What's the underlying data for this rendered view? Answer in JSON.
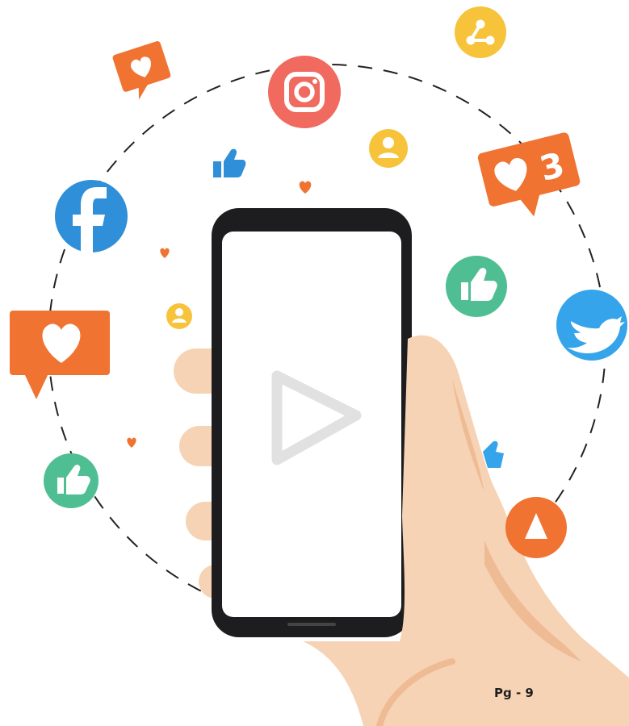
{
  "page": {
    "number_label": "Pg - 9"
  },
  "notification_badge": {
    "count": "3"
  },
  "icons": [
    "instagram-icon",
    "facebook-icon",
    "twitter-icon",
    "share-icon",
    "user-icon",
    "thumbs-up-icon",
    "heart-icon",
    "play-icon"
  ],
  "colors": {
    "instagram": "#f06a5f",
    "facebook": "#2f8fd8",
    "twitter": "#36a4ea",
    "like_green": "#4fbf93",
    "orange": "#f07332",
    "yellow": "#f7c33a",
    "skin": "#f6d3b4",
    "skin_shadow": "#eebb94",
    "phone_frame": "#1d1d1f"
  }
}
